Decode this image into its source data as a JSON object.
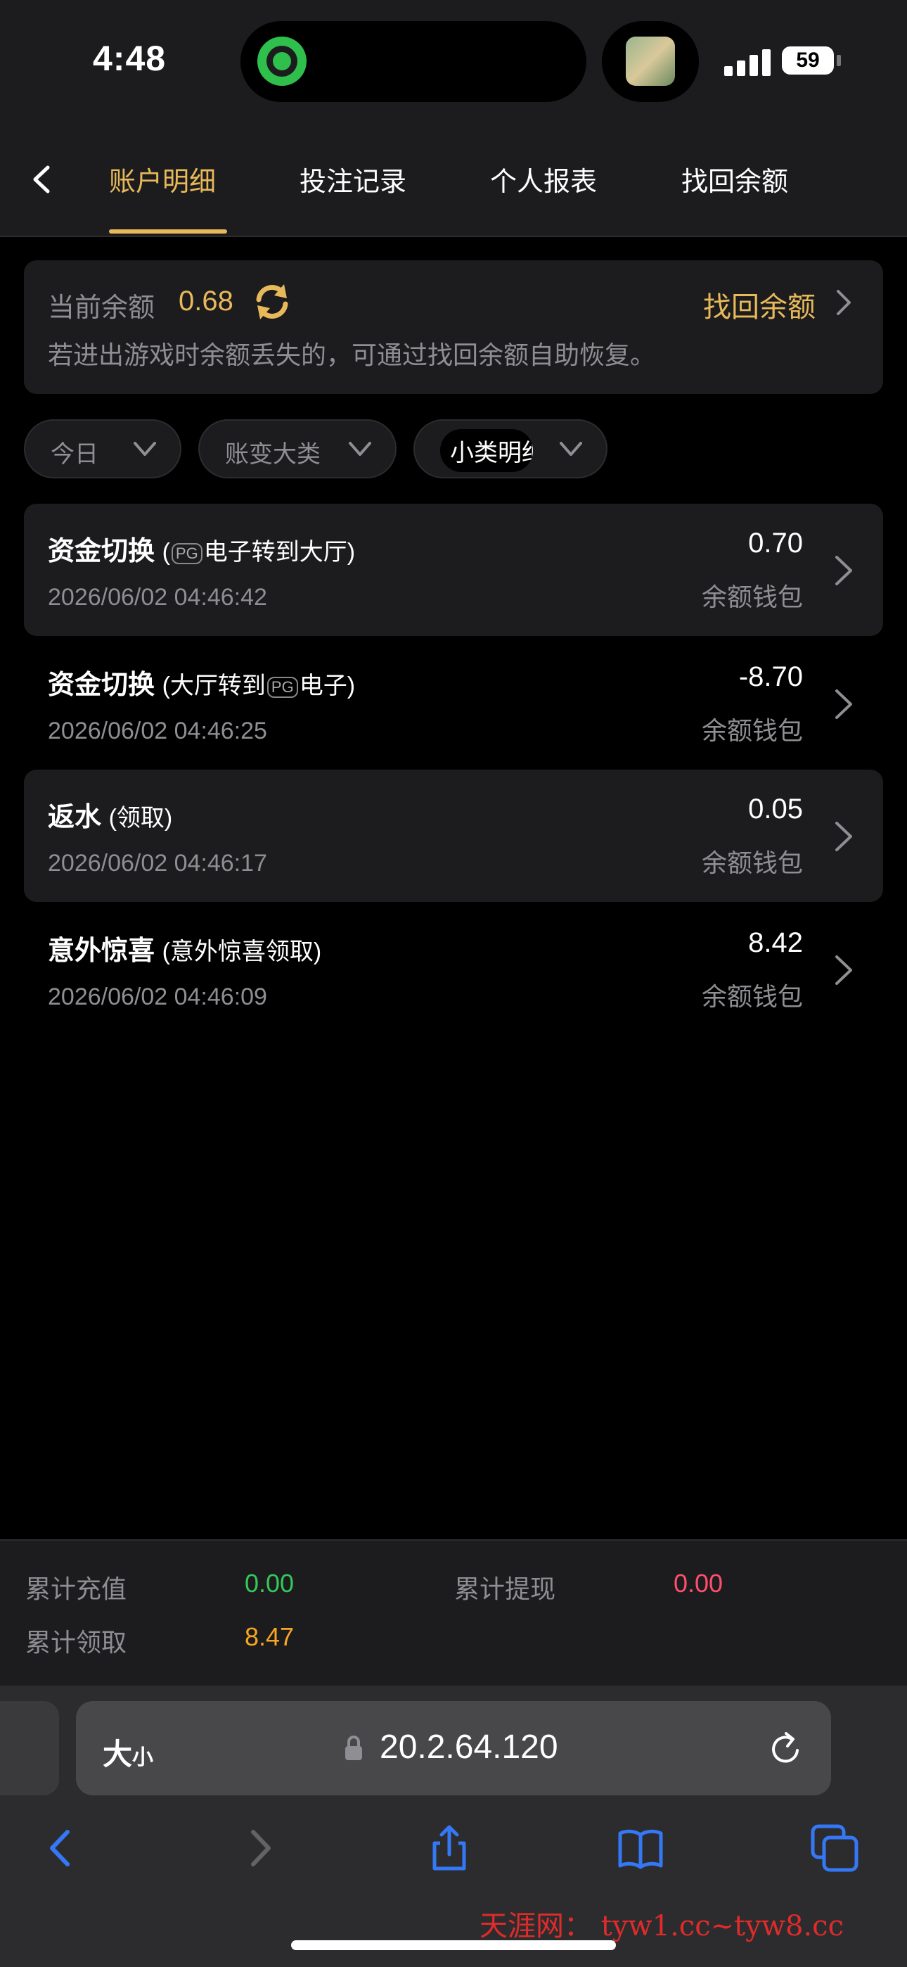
{
  "status": {
    "time": "4:48",
    "battery": "59"
  },
  "tabs": [
    {
      "label": "账户明细",
      "active": true
    },
    {
      "label": "投注记录"
    },
    {
      "label": "个人报表"
    },
    {
      "label": "找回余额"
    }
  ],
  "balance": {
    "label": "当前余额",
    "value": "0.68",
    "recover_link": "找回余额",
    "hint": "若进出游戏时余额丢失的，可通过找回余额自助恢复。"
  },
  "filters": [
    "今日",
    "账变大类",
    "小类明细"
  ],
  "records": [
    {
      "title": "资金切换",
      "sub_open": "(",
      "sub_mid_pre": "",
      "pg": "PG",
      "sub_mid_post": "电子转到大厅",
      "sub_close": ")",
      "date": "2026/06/02 04:46:42",
      "amount": "0.70",
      "wallet": "余额钱包"
    },
    {
      "title": "资金切换",
      "sub_open": "(",
      "sub_mid_pre": "大厅转到",
      "pg": "PG",
      "sub_mid_post": "电子",
      "sub_close": ")",
      "date": "2026/06/02 04:46:25",
      "amount": "-8.70",
      "wallet": "余额钱包"
    },
    {
      "title": "返水",
      "sub": "(领取)",
      "date": "2026/06/02 04:46:17",
      "amount": "0.05",
      "wallet": "余额钱包"
    },
    {
      "title": "意外惊喜",
      "sub": "(意外惊喜领取)",
      "date": "2026/06/02 04:46:09",
      "amount": "8.42",
      "wallet": "余额钱包"
    }
  ],
  "summary": {
    "deposit_label": "累计充值",
    "deposit_value": "0.00",
    "withdraw_label": "累计提现",
    "withdraw_value": "0.00",
    "claim_label": "累计领取",
    "claim_value": "8.47"
  },
  "browser": {
    "aa_big": "大",
    "aa_small": "小",
    "url": "20.2.64.120"
  },
  "watermark": "天涯网： tyw1.cc~tyw8.cc",
  "colors": {
    "accent": "#e7b95a",
    "green": "#34c759",
    "red": "#ff4d6d",
    "orange": "#f5a623",
    "blue": "#3478f6"
  }
}
